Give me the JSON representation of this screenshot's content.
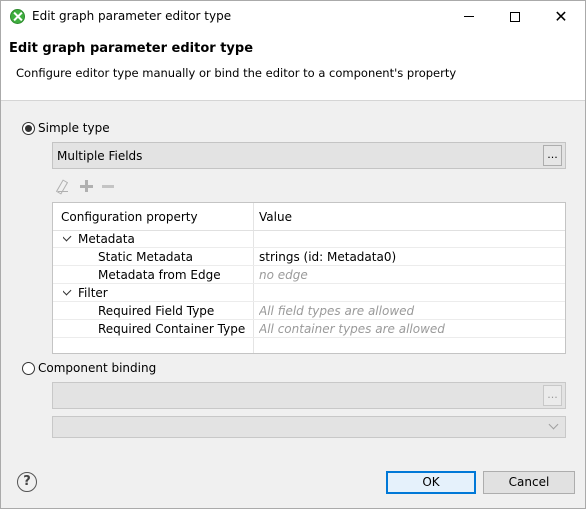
{
  "window": {
    "title": "Edit graph parameter editor type"
  },
  "header": {
    "title": "Edit graph parameter editor type",
    "description": "Configure editor type manually or bind the editor to a component's property"
  },
  "simple_type": {
    "label": "Simple type",
    "selected": true,
    "field_value": "Multiple Fields",
    "browse_label": "..."
  },
  "table": {
    "columns": [
      "Configuration property",
      "Value"
    ],
    "rows": [
      {
        "kind": "group",
        "property": "Metadata",
        "value": ""
      },
      {
        "kind": "child",
        "property": "Static Metadata",
        "value": "strings (id: Metadata0)",
        "muted": false
      },
      {
        "kind": "child",
        "property": "Metadata from Edge",
        "value": "no edge",
        "muted": true
      },
      {
        "kind": "group",
        "property": "Filter",
        "value": ""
      },
      {
        "kind": "child",
        "property": "Required Field Type",
        "value": "All field types are allowed",
        "muted": true
      },
      {
        "kind": "child",
        "property": "Required Container Type",
        "value": "All container types are allowed",
        "muted": true
      }
    ]
  },
  "component_binding": {
    "label": "Component binding",
    "selected": false,
    "field_value": "",
    "browse_label": "..."
  },
  "buttons": {
    "ok": "OK",
    "cancel": "Cancel",
    "help": "?"
  }
}
